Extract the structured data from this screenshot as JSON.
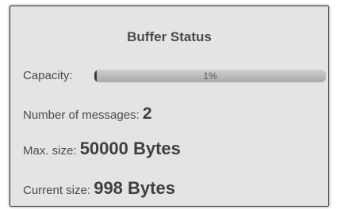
{
  "panel": {
    "title": "Buffer Status",
    "capacity": {
      "label": "Capacity:",
      "percent_text": "1%",
      "fraction": 0.01
    },
    "messages": {
      "label": "Number of messages:",
      "value": "2"
    },
    "max_size": {
      "label": "Max. size:",
      "value": "50000 Bytes"
    },
    "current_size": {
      "label": "Current size:",
      "value": "998 Bytes"
    }
  },
  "colors": {
    "panel_background": "#e4e4e4",
    "text": "#4a4a4a",
    "progress_fill": "#3a3a3a",
    "progress_track": "#bdbdbd"
  }
}
